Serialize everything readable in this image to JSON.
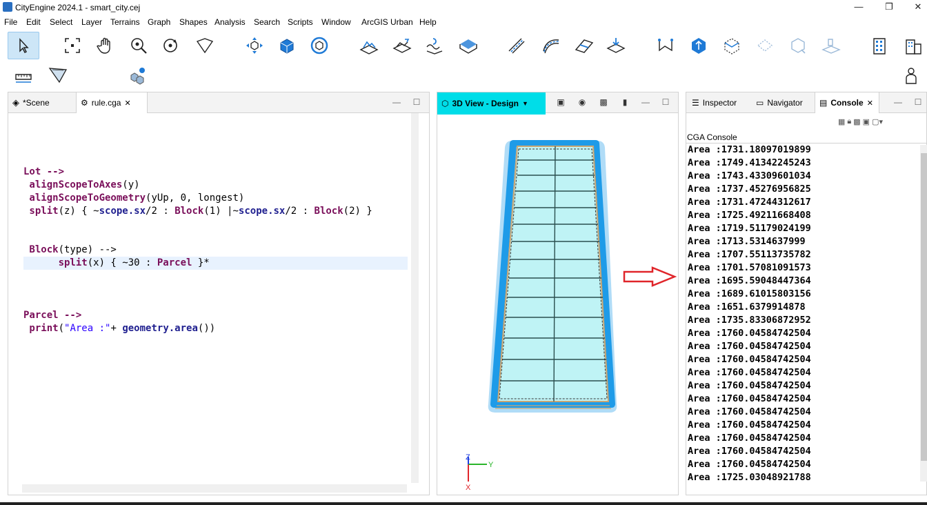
{
  "window": {
    "title": "CityEngine 2024.1 - smart_city.cej",
    "minimize": "—",
    "maximize": "❐",
    "close": "✕"
  },
  "menu": [
    "File",
    "Edit",
    "Select",
    "Layer",
    "Terrains",
    "Graph",
    "Shapes",
    "Analysis",
    "Search",
    "Scripts",
    "Window",
    "ArcGIS Urban",
    "Help"
  ],
  "toolbar_icons": [
    "select-icon",
    "frame-select-icon",
    "pan-icon",
    "zoom-icon",
    "orbit-icon",
    "lasso-icon",
    "move-icon",
    "scale-icon",
    "rotate-icon",
    "terrain-icon",
    "align-terrain-icon",
    "reshape-terrain-icon",
    "shape-terrain-icon",
    "street-icon",
    "curved-street-icon",
    "street-grid-icon",
    "align-street-icon",
    "polygon-icon",
    "extrude-icon",
    "edit-shape-icon",
    "subdivide-icon",
    "mass-icon",
    "terrain-edit-icon",
    "building-icon",
    "building-group-icon",
    "measure-icon",
    "viewport-icon",
    "cluster-icon",
    "user-icon"
  ],
  "editor": {
    "tabs": [
      {
        "label": "*Scene",
        "icon": "layers-icon"
      },
      {
        "label": "rule.cga",
        "icon": "cga-file-icon",
        "close": "✕"
      }
    ],
    "lines": [
      {
        "segments": [
          {
            "t": "Lot -->",
            "c": "kw"
          }
        ]
      },
      {
        "segments": [
          {
            "t": " alignScopeToAxes",
            "c": "kw"
          },
          {
            "t": "(y)",
            "c": "plain"
          }
        ]
      },
      {
        "segments": [
          {
            "t": " alignScopeToGeometry",
            "c": "kw"
          },
          {
            "t": "(yUp, 0, longest)",
            "c": "plain"
          }
        ]
      },
      {
        "segments": [
          {
            "t": " split",
            "c": "kw"
          },
          {
            "t": "(z) { ~",
            "c": "plain"
          },
          {
            "t": "scope.sx",
            "c": "fn"
          },
          {
            "t": "/2 : ",
            "c": "plain"
          },
          {
            "t": "Block",
            "c": "kw"
          },
          {
            "t": "(1) |~",
            "c": "plain"
          },
          {
            "t": "scope.sx",
            "c": "fn"
          },
          {
            "t": "/2 : ",
            "c": "plain"
          },
          {
            "t": "Block",
            "c": "kw"
          },
          {
            "t": "(2) }",
            "c": "plain"
          }
        ]
      },
      {
        "segments": [
          {
            "t": " Block",
            "c": "kw"
          },
          {
            "t": "(type) -->",
            "c": "plain"
          }
        ]
      },
      {
        "segments": [
          {
            "t": "      split",
            "c": "kw"
          },
          {
            "t": "(x) { ~30 : ",
            "c": "plain"
          },
          {
            "t": "Parcel",
            "c": "kw"
          },
          {
            "t": " }*",
            "c": "plain"
          }
        ]
      },
      {
        "segments": [
          {
            "t": "Parcel -->",
            "c": "kw"
          }
        ]
      },
      {
        "segments": [
          {
            "t": " print",
            "c": "kw"
          },
          {
            "t": "(",
            "c": "plain"
          },
          {
            "t": "\"Area :\"",
            "c": "str"
          },
          {
            "t": "+ ",
            "c": "plain"
          },
          {
            "t": "geometry.area",
            "c": "fn"
          },
          {
            "t": "())",
            "c": "plain"
          }
        ]
      }
    ]
  },
  "viewport": {
    "tab_label": "3D View - Design",
    "axis_labels": {
      "z": "Z",
      "y": "Y",
      "x": "X"
    },
    "accent": "#00dde8",
    "block_outline": "#1e9be8",
    "parcel_fill": "#bff3f5",
    "arrow_color": "#e0252a"
  },
  "console": {
    "tabs": [
      {
        "label": "Inspector",
        "icon": "inspector-icon"
      },
      {
        "label": "Navigator",
        "icon": "folder-icon"
      },
      {
        "label": "Console",
        "icon": "console-icon",
        "close": "✕"
      }
    ],
    "heading": "CGA Console",
    "lines": [
      "Area :1731.18097019899",
      "Area :1749.41342245243",
      "Area :1743.43309601034",
      "Area :1737.45276956825",
      "Area :1731.47244312617",
      "Area :1725.49211668408",
      "Area :1719.51179024199",
      "Area :1713.5314637999",
      "Area :1707.55113735782",
      "Area :1701.57081091573",
      "Area :1695.59048447364",
      "Area :1689.61015803156",
      "Area :1651.6379914878",
      "Area :1735.83306872952",
      "Area :1760.04584742504",
      "Area :1760.04584742504",
      "Area :1760.04584742504",
      "Area :1760.04584742504",
      "Area :1760.04584742504",
      "Area :1760.04584742504",
      "Area :1760.04584742504",
      "Area :1760.04584742504",
      "Area :1760.04584742504",
      "Area :1760.04584742504",
      "Area :1760.04584742504",
      "Area :1725.03048921788"
    ]
  }
}
